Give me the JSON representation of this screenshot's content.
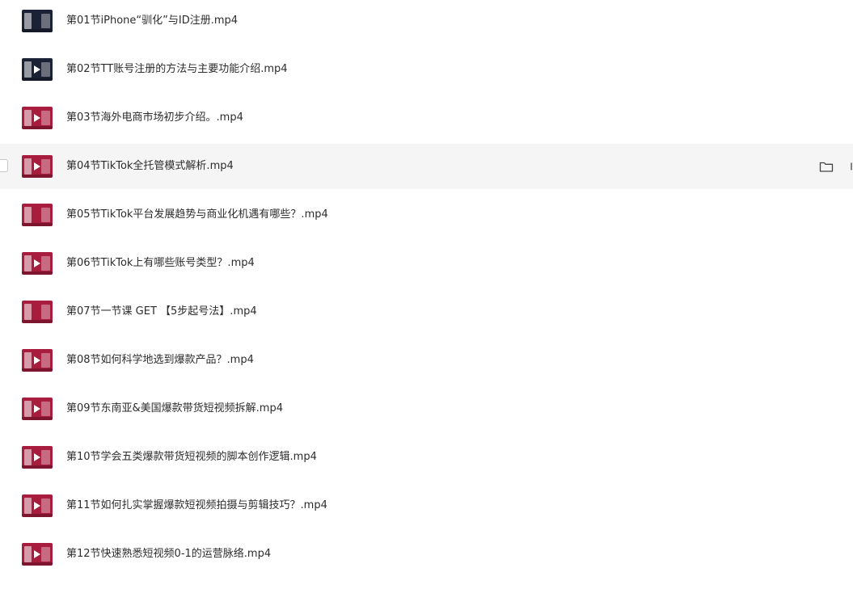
{
  "files": [
    {
      "name": "第01节iPhone“驯化”与ID注册.mp4",
      "thumb_icon": "video-thumbnail-icon",
      "thumb_color": "#1c2236"
    },
    {
      "name": "第02节TT账号注册的方法与主要功能介绍.mp4",
      "thumb_icon": "video-thumbnail-icon",
      "thumb_color": "#1c2236"
    },
    {
      "name": "第03节海外电商市场初步介绍。.mp4",
      "thumb_icon": "video-thumbnail-icon",
      "thumb_color": "#a81d3e"
    },
    {
      "name": "第04节TikTok全托管模式解析.mp4",
      "thumb_icon": "video-thumbnail-icon",
      "thumb_color": "#a81d3e",
      "hovered": true
    },
    {
      "name": "第05节TikTok平台发展趋势与商业化机遇有哪些？.mp4",
      "thumb_icon": "video-thumbnail-icon",
      "thumb_color": "#a81d3e"
    },
    {
      "name": "第06节TikTok上有哪些账号类型？.mp4",
      "thumb_icon": "video-thumbnail-icon",
      "thumb_color": "#a81d3e"
    },
    {
      "name": "第07节一节课 GET 【5步起号法】.mp4",
      "thumb_icon": "video-thumbnail-icon",
      "thumb_color": "#a81d3e"
    },
    {
      "name": "第08节如何科学地选到爆款产品？.mp4",
      "thumb_icon": "video-thumbnail-icon",
      "thumb_color": "#a81d3e"
    },
    {
      "name": "第09节东南亚&美国爆款带货短视频拆解.mp4",
      "thumb_icon": "video-thumbnail-icon",
      "thumb_color": "#a81d3e"
    },
    {
      "name": "第10节学会五类爆款带货短视频的脚本创作逻辑.mp4",
      "thumb_icon": "video-thumbnail-icon",
      "thumb_color": "#a81d3e"
    },
    {
      "name": "第11节如何扎实掌握爆款短视频拍摄与剪辑技巧？.mp4",
      "thumb_icon": "video-thumbnail-icon",
      "thumb_color": "#a81d3e"
    },
    {
      "name": "第12节快速熟悉短视频0-1的运营脉络.mp4",
      "thumb_icon": "video-thumbnail-icon",
      "thumb_color": "#a81d3e"
    }
  ],
  "hover_actions": {
    "folder_icon": "folder-icon",
    "more_icon": "partial-action-icon"
  },
  "colors": {
    "hover_background": "#f5f5f6",
    "text": "#2c2c2c",
    "thumb_dark": "#1c2236",
    "thumb_red": "#a81d3e"
  }
}
